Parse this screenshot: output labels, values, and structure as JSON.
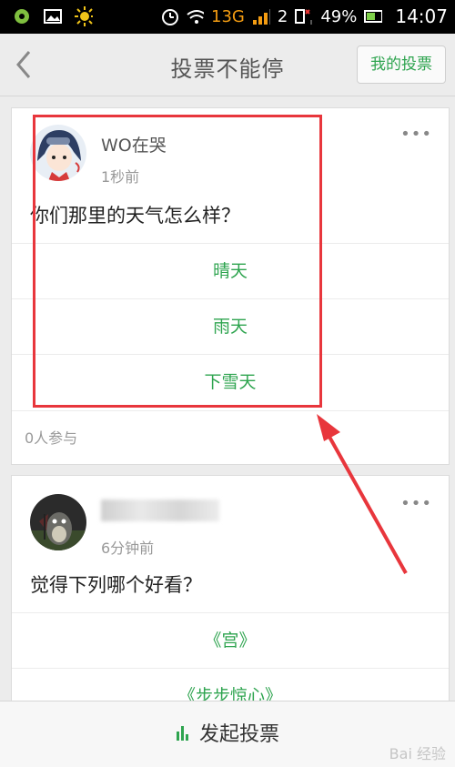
{
  "status_bar": {
    "network": "3G",
    "battery": "49%",
    "time": "14:07",
    "sim_label": "1",
    "sim2_label": "2"
  },
  "header": {
    "title": "投票不能停",
    "my_votes_label": "我的投票"
  },
  "feed": {
    "post1": {
      "username": "WO在哭",
      "time": "1秒前",
      "question": "你们那里的天气怎么样？",
      "options": [
        "晴天",
        "雨天",
        "下雪天"
      ],
      "participants": "0人参与",
      "more": "•••"
    },
    "post2": {
      "time": "6分钟前",
      "question": "觉得下列哪个好看？",
      "options": [
        "《宫》",
        "《步步惊心》"
      ],
      "more": "•••"
    }
  },
  "bottom": {
    "start_vote_label": "发起投票"
  },
  "watermark": "Bai 经验",
  "colors": {
    "accent": "#2ea44f",
    "highlight": "#e8363c"
  }
}
